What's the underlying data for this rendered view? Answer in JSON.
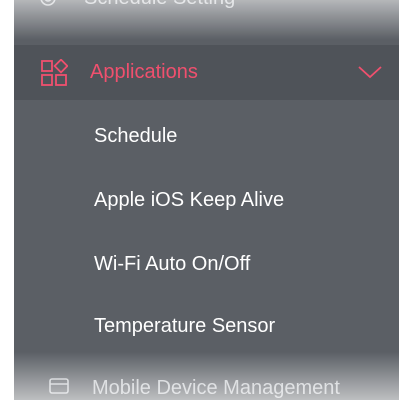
{
  "menu": {
    "top_partial": {
      "label": "Schedule Setting",
      "icon": "gear-icon"
    },
    "applications": {
      "label": "Applications",
      "icon": "applications-grid-icon",
      "expanded": true,
      "accent_color": "#f0506e"
    },
    "submenu": [
      {
        "label": "Schedule"
      },
      {
        "label": "Apple iOS Keep Alive"
      },
      {
        "label": "Wi-Fi Auto On/Off"
      },
      {
        "label": "Temperature Sensor"
      }
    ],
    "bottom_partial": {
      "label": "Mobile Device Management",
      "icon": "device-icon"
    }
  },
  "colors": {
    "menu_background": "#5b5f65",
    "active_row_background": "#4f5359",
    "text": "#ffffff"
  }
}
